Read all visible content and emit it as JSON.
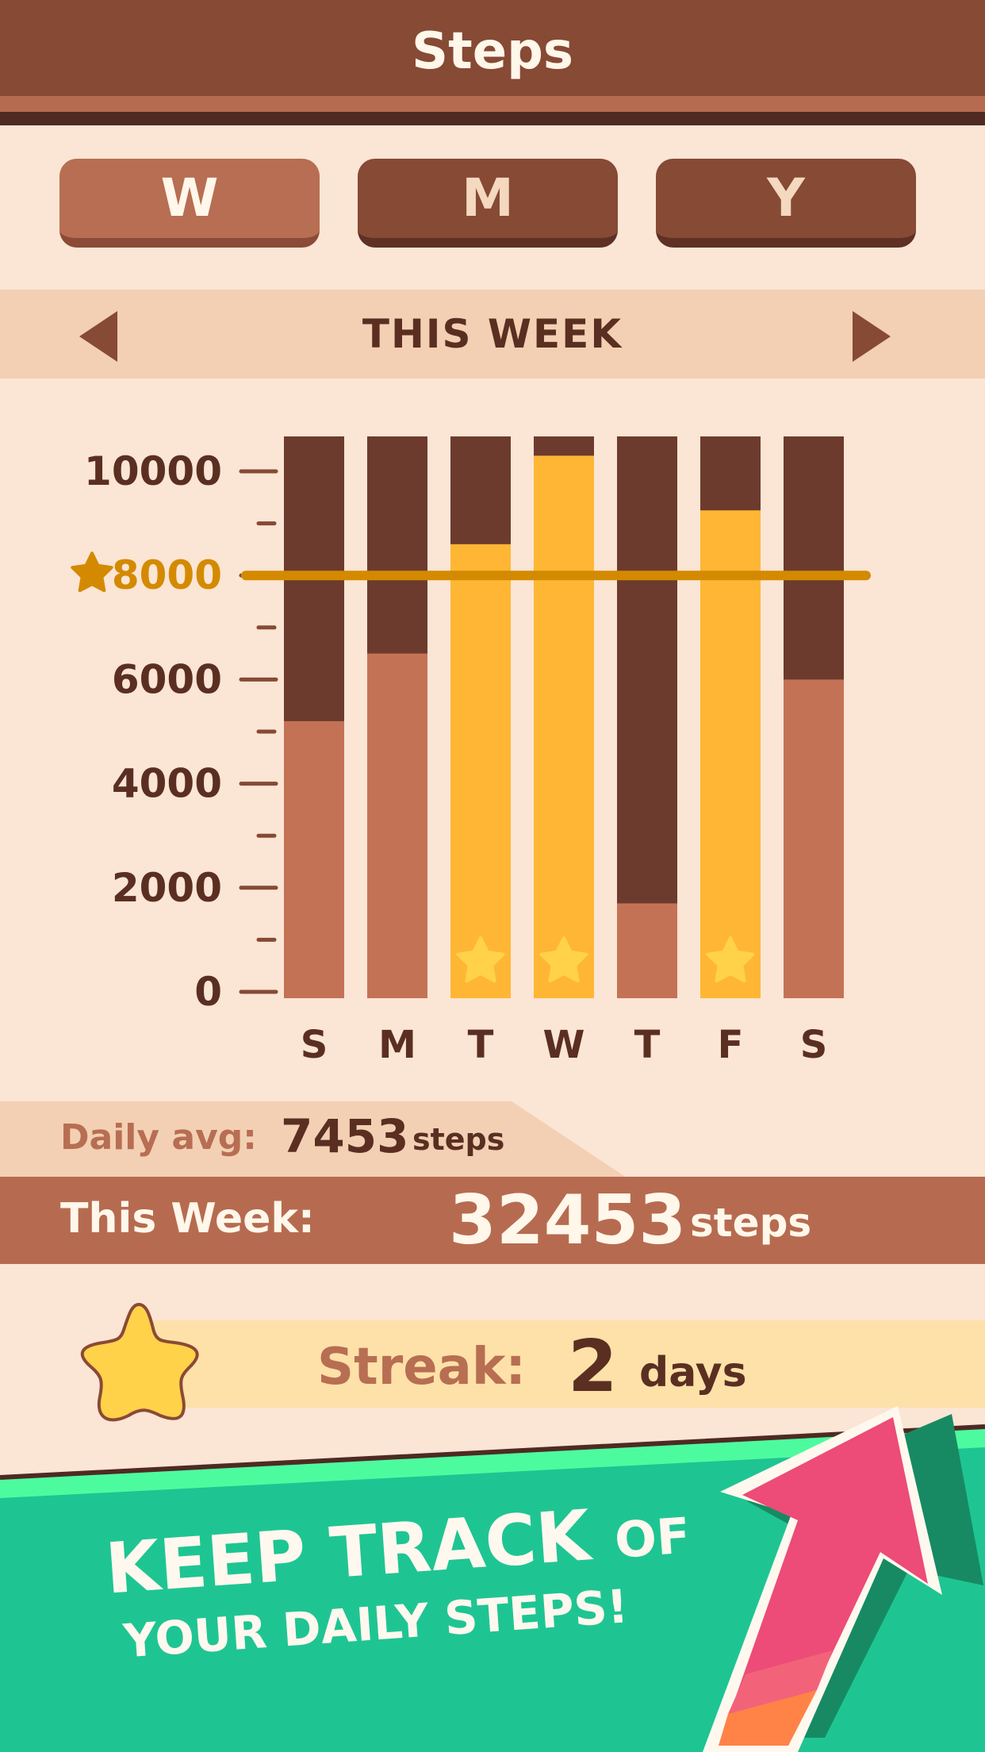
{
  "header": {
    "title": "Steps"
  },
  "segments": [
    {
      "label": "W",
      "active": true
    },
    {
      "label": "M",
      "active": false
    },
    {
      "label": "Y",
      "active": false
    }
  ],
  "period": {
    "label": "THIS WEEK"
  },
  "chart_data": {
    "type": "bar",
    "categories": [
      "S",
      "M",
      "T",
      "W",
      "T",
      "F",
      "S"
    ],
    "values": [
      5200,
      6500,
      8600,
      10300,
      1700,
      9250,
      6000
    ],
    "goal_value": 8000,
    "goal_label": "8000",
    "goal_reached": [
      false,
      false,
      true,
      true,
      false,
      true,
      false
    ],
    "ylim": [
      0,
      10500
    ],
    "yticks": [
      0,
      2000,
      4000,
      6000,
      8000,
      10000
    ],
    "ytick_labels": [
      "0",
      "2000",
      "4000",
      "6000",
      "8000",
      "10000"
    ],
    "minor_ticks": [
      1000,
      3000,
      5000,
      7000,
      9000
    ],
    "colors": {
      "track": "#6d3b2d",
      "bar": "#c47255",
      "bar_goal": "#ffb634",
      "goal_line": "#d48a00",
      "star": "#ffd24a",
      "axis": "#864a35",
      "label": "#5a2f22"
    }
  },
  "stats": {
    "daily_avg_label": "Daily avg:",
    "daily_avg_value": "7453",
    "daily_avg_unit": "steps",
    "week_label": "This Week:",
    "week_value": "32453",
    "week_unit": "steps"
  },
  "streak": {
    "label": "Streak:",
    "value": "2",
    "unit": "days"
  },
  "banner": {
    "line1": "KEEP TRACK",
    "line1_small": "OF",
    "line2": "YOUR DAILY STEPS!"
  },
  "colors": {
    "banner": "#1ec592",
    "banner_light": "#4dfb9f",
    "arrow": "#ec4c77",
    "arrow_orange": "#ff8347"
  }
}
